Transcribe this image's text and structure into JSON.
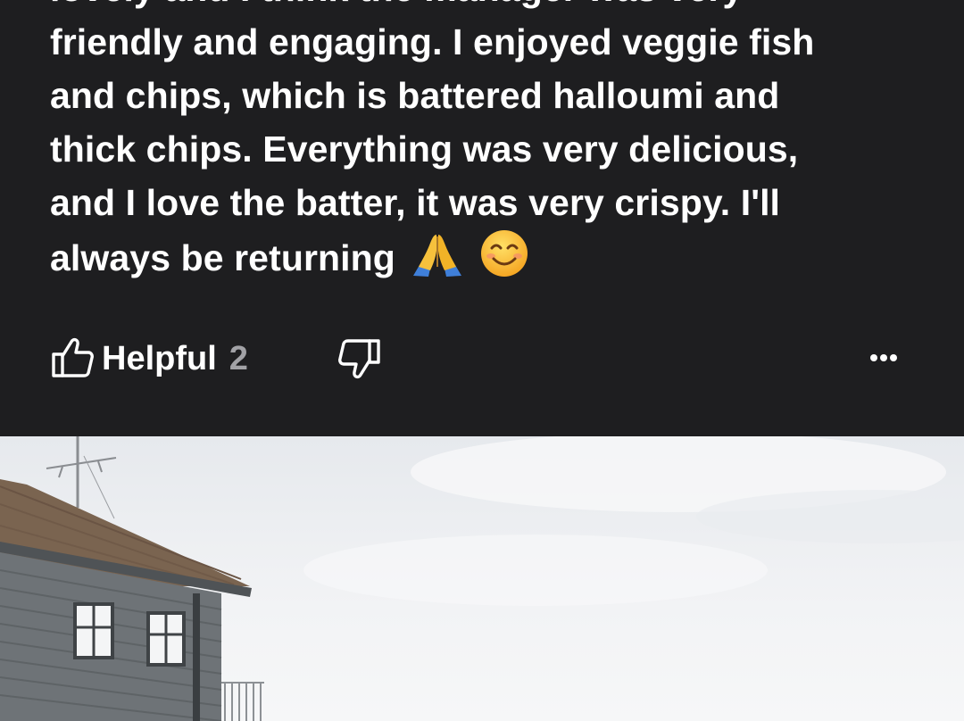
{
  "review": {
    "lines": [
      "lovely and I think the manager was very",
      "friendly and engaging. I enjoyed veggie fish",
      "and chips, which is battered halloumi and",
      "thick chips. Everything was very delicious,",
      "and I love the batter, it was very crispy. I'll",
      "always be returning"
    ],
    "emojis": [
      "folded-hands-emoji",
      "smiling-face-emoji"
    ]
  },
  "actions": {
    "helpful_label": "Helpful",
    "helpful_count": "2",
    "icons": {
      "helpful": "thumbs-up-icon",
      "not_helpful": "thumbs-down-icon",
      "more": "more-options-icon"
    }
  },
  "photo": {
    "subject": "grey wooden building with tiled roof and antenna under an overcast sky"
  },
  "colors": {
    "card_background": "#1e1e20",
    "text_primary": "#ffffff",
    "text_secondary": "#a2a2a6"
  }
}
